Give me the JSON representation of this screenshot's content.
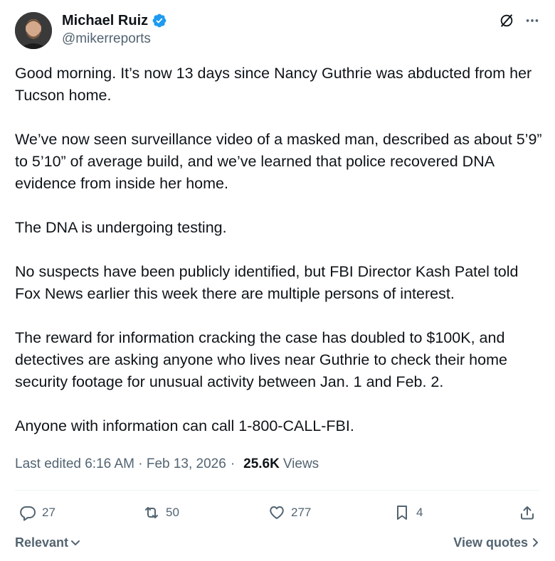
{
  "author": {
    "name": "Michael Ruiz",
    "handle": "@mikerreports",
    "verified_color": "#1d9bf0"
  },
  "post": {
    "paragraphs": [
      "Good morning. It’s now 13 days since Nancy Guthrie was abducted from her Tucson home.",
      "We’ve now seen surveillance video of a masked man, described as about 5’9” to 5’10” of average build, and we’ve learned that police recovered DNA evidence from inside her home.",
      "The DNA is undergoing testing.",
      "No suspects have been publicly identified, but FBI Director Kash Patel told Fox News earlier this week there are multiple persons of interest.",
      "The reward for information cracking the case has doubled to $100K, and detectives are asking anyone who lives near Guthrie to check their home security footage for unusual activity between Jan. 1 and Feb. 2.",
      "Anyone with information can call 1-800-CALL-FBI."
    ]
  },
  "meta": {
    "edited": "Last edited 6:16 AM · Feb 13, 2026",
    "separator": "·",
    "views_count": "25.6K",
    "views_label": "Views"
  },
  "actions": {
    "replies": "27",
    "reposts": "50",
    "likes": "277",
    "bookmarks": "4"
  },
  "footer": {
    "sort_label": "Relevant",
    "view_quotes": "View quotes"
  },
  "icons": [
    "grok-icon",
    "more-icon",
    "verified-icon",
    "reply-icon",
    "repost-icon",
    "like-icon",
    "bookmark-icon",
    "share-icon",
    "chevron-down-icon",
    "chevron-right-icon"
  ]
}
